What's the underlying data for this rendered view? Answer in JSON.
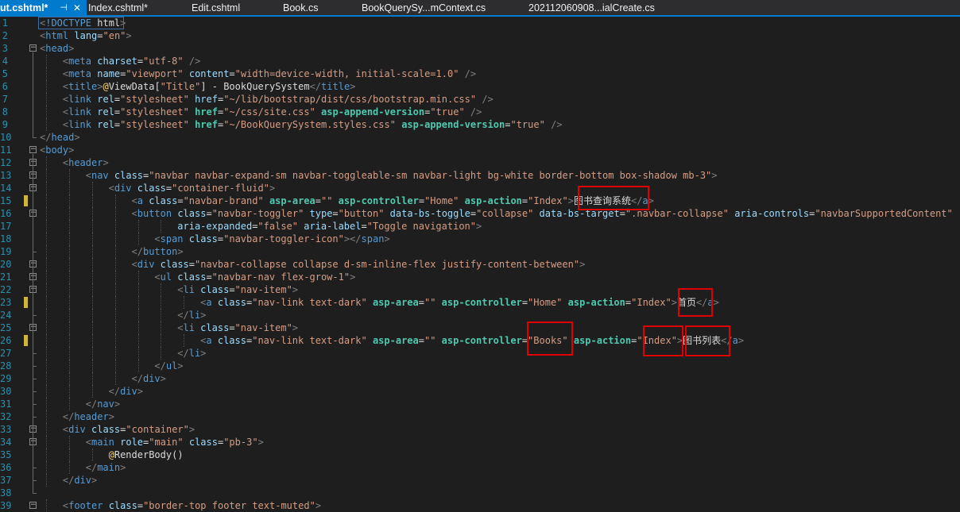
{
  "tabs": [
    {
      "label": "ut.cshtml*",
      "pin": "⊣",
      "close": "✕",
      "active": true
    },
    {
      "label": "Index.cshtml*"
    },
    {
      "label": "Edit.cshtml"
    },
    {
      "label": "Book.cs"
    },
    {
      "label": "BookQuerySy...mContext.cs"
    },
    {
      "label": "202112060908...ialCreate.cs"
    }
  ],
  "colors": {
    "accent": "#007acc",
    "highlight": "#e00000",
    "modified": "#cfb53b"
  },
  "icons": {
    "pin": "pin-icon",
    "close": "close-icon",
    "fold": "fold-toggle-icon"
  },
  "lines": [
    {
      "n": "1",
      "indent": 4,
      "tokens": [
        [
          "d",
          "<"
        ],
        [
          "t",
          "!DOCTYPE"
        ],
        [
          "p",
          " html"
        ],
        [
          "d",
          ">"
        ]
      ]
    },
    {
      "n": "2",
      "indent": 4,
      "tokens": [
        [
          "d",
          "<"
        ],
        [
          "t",
          "html"
        ],
        [
          "a",
          " lang"
        ],
        [
          "p",
          "="
        ],
        [
          "s",
          "\"en\""
        ],
        [
          "d",
          ">"
        ]
      ]
    },
    {
      "n": "3",
      "indent": 4,
      "tokens": [
        [
          "d",
          "<"
        ],
        [
          "t",
          "head"
        ],
        [
          "d",
          ">"
        ]
      ]
    },
    {
      "n": "4",
      "indent": 8,
      "tokens": [
        [
          "d",
          "<"
        ],
        [
          "t",
          "meta"
        ],
        [
          "a",
          " charset"
        ],
        [
          "p",
          "="
        ],
        [
          "s",
          "\"utf-8\""
        ],
        [
          "d",
          " />"
        ]
      ]
    },
    {
      "n": "5",
      "indent": 8,
      "tokens": [
        [
          "d",
          "<"
        ],
        [
          "t",
          "meta"
        ],
        [
          "a",
          " name"
        ],
        [
          "p",
          "="
        ],
        [
          "s",
          "\"viewport\""
        ],
        [
          "a",
          " content"
        ],
        [
          "p",
          "="
        ],
        [
          "s",
          "\"width=device-width, initial-scale=1.0\""
        ],
        [
          "d",
          " />"
        ]
      ]
    },
    {
      "n": "6",
      "indent": 8,
      "tokens": [
        [
          "d",
          "<"
        ],
        [
          "t",
          "title"
        ],
        [
          "d",
          ">"
        ],
        [
          "r",
          "@"
        ],
        [
          "p",
          "ViewData["
        ],
        [
          "s",
          "\"Title\""
        ],
        [
          "p",
          "] - BookQuerySystem"
        ],
        [
          "d",
          "</"
        ],
        [
          "t",
          "title"
        ],
        [
          "d",
          ">"
        ]
      ]
    },
    {
      "n": "7",
      "indent": 8,
      "tokens": [
        [
          "d",
          "<"
        ],
        [
          "t",
          "link"
        ],
        [
          "a",
          " rel"
        ],
        [
          "p",
          "="
        ],
        [
          "s",
          "\"stylesheet\""
        ],
        [
          "a",
          " href"
        ],
        [
          "p",
          "="
        ],
        [
          "s",
          "\"~/lib/bootstrap/dist/css/bootstrap.min.css\""
        ],
        [
          "d",
          " />"
        ]
      ]
    },
    {
      "n": "8",
      "indent": 8,
      "tokens": [
        [
          "d",
          "<"
        ],
        [
          "t",
          "link"
        ],
        [
          "a",
          " rel"
        ],
        [
          "p",
          "="
        ],
        [
          "s",
          "\"stylesheet\""
        ],
        [
          "ta",
          " href"
        ],
        [
          "p",
          "="
        ],
        [
          "s",
          "\"~/css/site.css\""
        ],
        [
          "ta",
          " asp-append-version"
        ],
        [
          "p",
          "="
        ],
        [
          "s",
          "\"true\""
        ],
        [
          "d",
          " />"
        ]
      ]
    },
    {
      "n": "9",
      "indent": 8,
      "tokens": [
        [
          "d",
          "<"
        ],
        [
          "t",
          "link"
        ],
        [
          "a",
          " rel"
        ],
        [
          "p",
          "="
        ],
        [
          "s",
          "\"stylesheet\""
        ],
        [
          "ta",
          " href"
        ],
        [
          "p",
          "="
        ],
        [
          "s",
          "\"~/BookQuerySystem.styles.css\""
        ],
        [
          "ta",
          " asp-append-version"
        ],
        [
          "p",
          "="
        ],
        [
          "s",
          "\"true\""
        ],
        [
          "d",
          " />"
        ]
      ]
    },
    {
      "n": "10",
      "indent": 4,
      "tokens": [
        [
          "d",
          "</"
        ],
        [
          "t",
          "head"
        ],
        [
          "d",
          ">"
        ]
      ]
    },
    {
      "n": "11",
      "indent": 4,
      "tokens": [
        [
          "d",
          "<"
        ],
        [
          "t",
          "body"
        ],
        [
          "d",
          ">"
        ]
      ]
    },
    {
      "n": "12",
      "indent": 8,
      "tokens": [
        [
          "d",
          "<"
        ],
        [
          "t",
          "header"
        ],
        [
          "d",
          ">"
        ]
      ]
    },
    {
      "n": "13",
      "indent": 12,
      "tokens": [
        [
          "d",
          "<"
        ],
        [
          "t",
          "nav"
        ],
        [
          "a",
          " class"
        ],
        [
          "p",
          "="
        ],
        [
          "s",
          "\"navbar navbar-expand-sm navbar-toggleable-sm navbar-light bg-white border-bottom box-shadow mb-3\""
        ],
        [
          "d",
          ">"
        ]
      ]
    },
    {
      "n": "14",
      "indent": 16,
      "tokens": [
        [
          "d",
          "<"
        ],
        [
          "t",
          "div"
        ],
        [
          "a",
          " class"
        ],
        [
          "p",
          "="
        ],
        [
          "s",
          "\"container-fluid\""
        ],
        [
          "d",
          ">"
        ]
      ]
    },
    {
      "n": "15",
      "indent": 20,
      "tokens": [
        [
          "d",
          "<"
        ],
        [
          "t",
          "a"
        ],
        [
          "a",
          " class"
        ],
        [
          "p",
          "="
        ],
        [
          "s",
          "\"navbar-brand\""
        ],
        [
          "ta",
          " asp-area"
        ],
        [
          "p",
          "="
        ],
        [
          "s",
          "\"\""
        ],
        [
          "ta",
          " asp-controller"
        ],
        [
          "p",
          "="
        ],
        [
          "s",
          "\"Home\""
        ],
        [
          "ta",
          " asp-action"
        ],
        [
          "p",
          "="
        ],
        [
          "s",
          "\"Index\""
        ],
        [
          "d",
          ">"
        ],
        [
          "p",
          "图书查询系统"
        ],
        [
          "d",
          "</"
        ],
        [
          "t",
          "a"
        ],
        [
          "d",
          ">"
        ]
      ]
    },
    {
      "n": "16",
      "indent": 20,
      "tokens": [
        [
          "d",
          "<"
        ],
        [
          "t",
          "button"
        ],
        [
          "a",
          " class"
        ],
        [
          "p",
          "="
        ],
        [
          "s",
          "\"navbar-toggler\""
        ],
        [
          "a",
          " type"
        ],
        [
          "p",
          "="
        ],
        [
          "s",
          "\"button\""
        ],
        [
          "a",
          " data-bs-toggle"
        ],
        [
          "p",
          "="
        ],
        [
          "s",
          "\"collapse\""
        ],
        [
          "a",
          " data-bs-target"
        ],
        [
          "p",
          "="
        ],
        [
          "s",
          "\".navbar-collapse\""
        ],
        [
          "a",
          " aria-controls"
        ],
        [
          "p",
          "="
        ],
        [
          "s",
          "\"navbarSupportedContent\""
        ]
      ]
    },
    {
      "n": "17",
      "indent": 28,
      "tokens": [
        [
          "a",
          "aria-expanded"
        ],
        [
          "p",
          "="
        ],
        [
          "s",
          "\"false\""
        ],
        [
          "a",
          " aria-label"
        ],
        [
          "p",
          "="
        ],
        [
          "s",
          "\"Toggle navigation\""
        ],
        [
          "d",
          ">"
        ]
      ]
    },
    {
      "n": "18",
      "indent": 24,
      "tokens": [
        [
          "d",
          "<"
        ],
        [
          "t",
          "span"
        ],
        [
          "a",
          " class"
        ],
        [
          "p",
          "="
        ],
        [
          "s",
          "\"navbar-toggler-icon\""
        ],
        [
          "d",
          "></"
        ],
        [
          "t",
          "span"
        ],
        [
          "d",
          ">"
        ]
      ]
    },
    {
      "n": "19",
      "indent": 20,
      "tokens": [
        [
          "d",
          "</"
        ],
        [
          "t",
          "button"
        ],
        [
          "d",
          ">"
        ]
      ]
    },
    {
      "n": "20",
      "indent": 20,
      "tokens": [
        [
          "d",
          "<"
        ],
        [
          "t",
          "div"
        ],
        [
          "a",
          " class"
        ],
        [
          "p",
          "="
        ],
        [
          "s",
          "\"navbar-collapse collapse d-sm-inline-flex justify-content-between\""
        ],
        [
          "d",
          ">"
        ]
      ]
    },
    {
      "n": "21",
      "indent": 24,
      "tokens": [
        [
          "d",
          "<"
        ],
        [
          "t",
          "ul"
        ],
        [
          "a",
          " class"
        ],
        [
          "p",
          "="
        ],
        [
          "s",
          "\"navbar-nav flex-grow-1\""
        ],
        [
          "d",
          ">"
        ]
      ]
    },
    {
      "n": "22",
      "indent": 28,
      "tokens": [
        [
          "d",
          "<"
        ],
        [
          "t",
          "li"
        ],
        [
          "a",
          " class"
        ],
        [
          "p",
          "="
        ],
        [
          "s",
          "\"nav-item\""
        ],
        [
          "d",
          ">"
        ]
      ]
    },
    {
      "n": "23",
      "indent": 32,
      "tokens": [
        [
          "d",
          "<"
        ],
        [
          "t",
          "a"
        ],
        [
          "a",
          " class"
        ],
        [
          "p",
          "="
        ],
        [
          "s",
          "\"nav-link text-dark\""
        ],
        [
          "ta",
          " asp-area"
        ],
        [
          "p",
          "="
        ],
        [
          "s",
          "\"\""
        ],
        [
          "ta",
          " asp-controller"
        ],
        [
          "p",
          "="
        ],
        [
          "s",
          "\"Home\""
        ],
        [
          "ta",
          " asp-action"
        ],
        [
          "p",
          "="
        ],
        [
          "s",
          "\"Index\""
        ],
        [
          "d",
          ">"
        ],
        [
          "p",
          "首页"
        ],
        [
          "d",
          "</"
        ],
        [
          "t",
          "a"
        ],
        [
          "d",
          ">"
        ]
      ]
    },
    {
      "n": "24",
      "indent": 28,
      "tokens": [
        [
          "d",
          "</"
        ],
        [
          "t",
          "li"
        ],
        [
          "d",
          ">"
        ]
      ]
    },
    {
      "n": "25",
      "indent": 28,
      "tokens": [
        [
          "d",
          "<"
        ],
        [
          "t",
          "li"
        ],
        [
          "a",
          " class"
        ],
        [
          "p",
          "="
        ],
        [
          "s",
          "\"nav-item\""
        ],
        [
          "d",
          ">"
        ]
      ]
    },
    {
      "n": "26",
      "indent": 32,
      "tokens": [
        [
          "d",
          "<"
        ],
        [
          "t",
          "a"
        ],
        [
          "a",
          " class"
        ],
        [
          "p",
          "="
        ],
        [
          "s",
          "\"nav-link text-dark\""
        ],
        [
          "ta",
          " asp-area"
        ],
        [
          "p",
          "="
        ],
        [
          "s",
          "\"\""
        ],
        [
          "ta",
          " asp-controller"
        ],
        [
          "p",
          "="
        ],
        [
          "s",
          "\"Books\""
        ],
        [
          "ta",
          " asp-action"
        ],
        [
          "p",
          "="
        ],
        [
          "s",
          "\"Index\""
        ],
        [
          "d",
          ">"
        ],
        [
          "p",
          "图书列表"
        ],
        [
          "d",
          "</"
        ],
        [
          "t",
          "a"
        ],
        [
          "d",
          ">"
        ]
      ]
    },
    {
      "n": "27",
      "indent": 28,
      "tokens": [
        [
          "d",
          "</"
        ],
        [
          "t",
          "li"
        ],
        [
          "d",
          ">"
        ]
      ]
    },
    {
      "n": "28",
      "indent": 24,
      "tokens": [
        [
          "d",
          "</"
        ],
        [
          "t",
          "ul"
        ],
        [
          "d",
          ">"
        ]
      ]
    },
    {
      "n": "29",
      "indent": 20,
      "tokens": [
        [
          "d",
          "</"
        ],
        [
          "t",
          "div"
        ],
        [
          "d",
          ">"
        ]
      ]
    },
    {
      "n": "30",
      "indent": 16,
      "tokens": [
        [
          "d",
          "</"
        ],
        [
          "t",
          "div"
        ],
        [
          "d",
          ">"
        ]
      ]
    },
    {
      "n": "31",
      "indent": 12,
      "tokens": [
        [
          "d",
          "</"
        ],
        [
          "t",
          "nav"
        ],
        [
          "d",
          ">"
        ]
      ]
    },
    {
      "n": "32",
      "indent": 8,
      "tokens": [
        [
          "d",
          "</"
        ],
        [
          "t",
          "header"
        ],
        [
          "d",
          ">"
        ]
      ]
    },
    {
      "n": "33",
      "indent": 8,
      "tokens": [
        [
          "d",
          "<"
        ],
        [
          "t",
          "div"
        ],
        [
          "a",
          " class"
        ],
        [
          "p",
          "="
        ],
        [
          "s",
          "\"container\""
        ],
        [
          "d",
          ">"
        ]
      ]
    },
    {
      "n": "34",
      "indent": 12,
      "tokens": [
        [
          "d",
          "<"
        ],
        [
          "t",
          "main"
        ],
        [
          "a",
          " role"
        ],
        [
          "p",
          "="
        ],
        [
          "s",
          "\"main\""
        ],
        [
          "a",
          " class"
        ],
        [
          "p",
          "="
        ],
        [
          "s",
          "\"pb-3\""
        ],
        [
          "d",
          ">"
        ]
      ]
    },
    {
      "n": "35",
      "indent": 16,
      "tokens": [
        [
          "r",
          "@"
        ],
        [
          "p",
          "RenderBody()"
        ]
      ]
    },
    {
      "n": "36",
      "indent": 12,
      "tokens": [
        [
          "d",
          "</"
        ],
        [
          "t",
          "main"
        ],
        [
          "d",
          ">"
        ]
      ]
    },
    {
      "n": "37",
      "indent": 8,
      "tokens": [
        [
          "d",
          "</"
        ],
        [
          "t",
          "div"
        ],
        [
          "d",
          ">"
        ]
      ]
    },
    {
      "n": "38",
      "indent": 0,
      "tokens": []
    },
    {
      "n": "39",
      "indent": 8,
      "tokens": [
        [
          "d",
          "<"
        ],
        [
          "t",
          "footer"
        ],
        [
          "a",
          " class"
        ],
        [
          "p",
          "="
        ],
        [
          "s",
          "\"border-top footer text-muted\""
        ],
        [
          "d",
          ">"
        ]
      ]
    }
  ]
}
